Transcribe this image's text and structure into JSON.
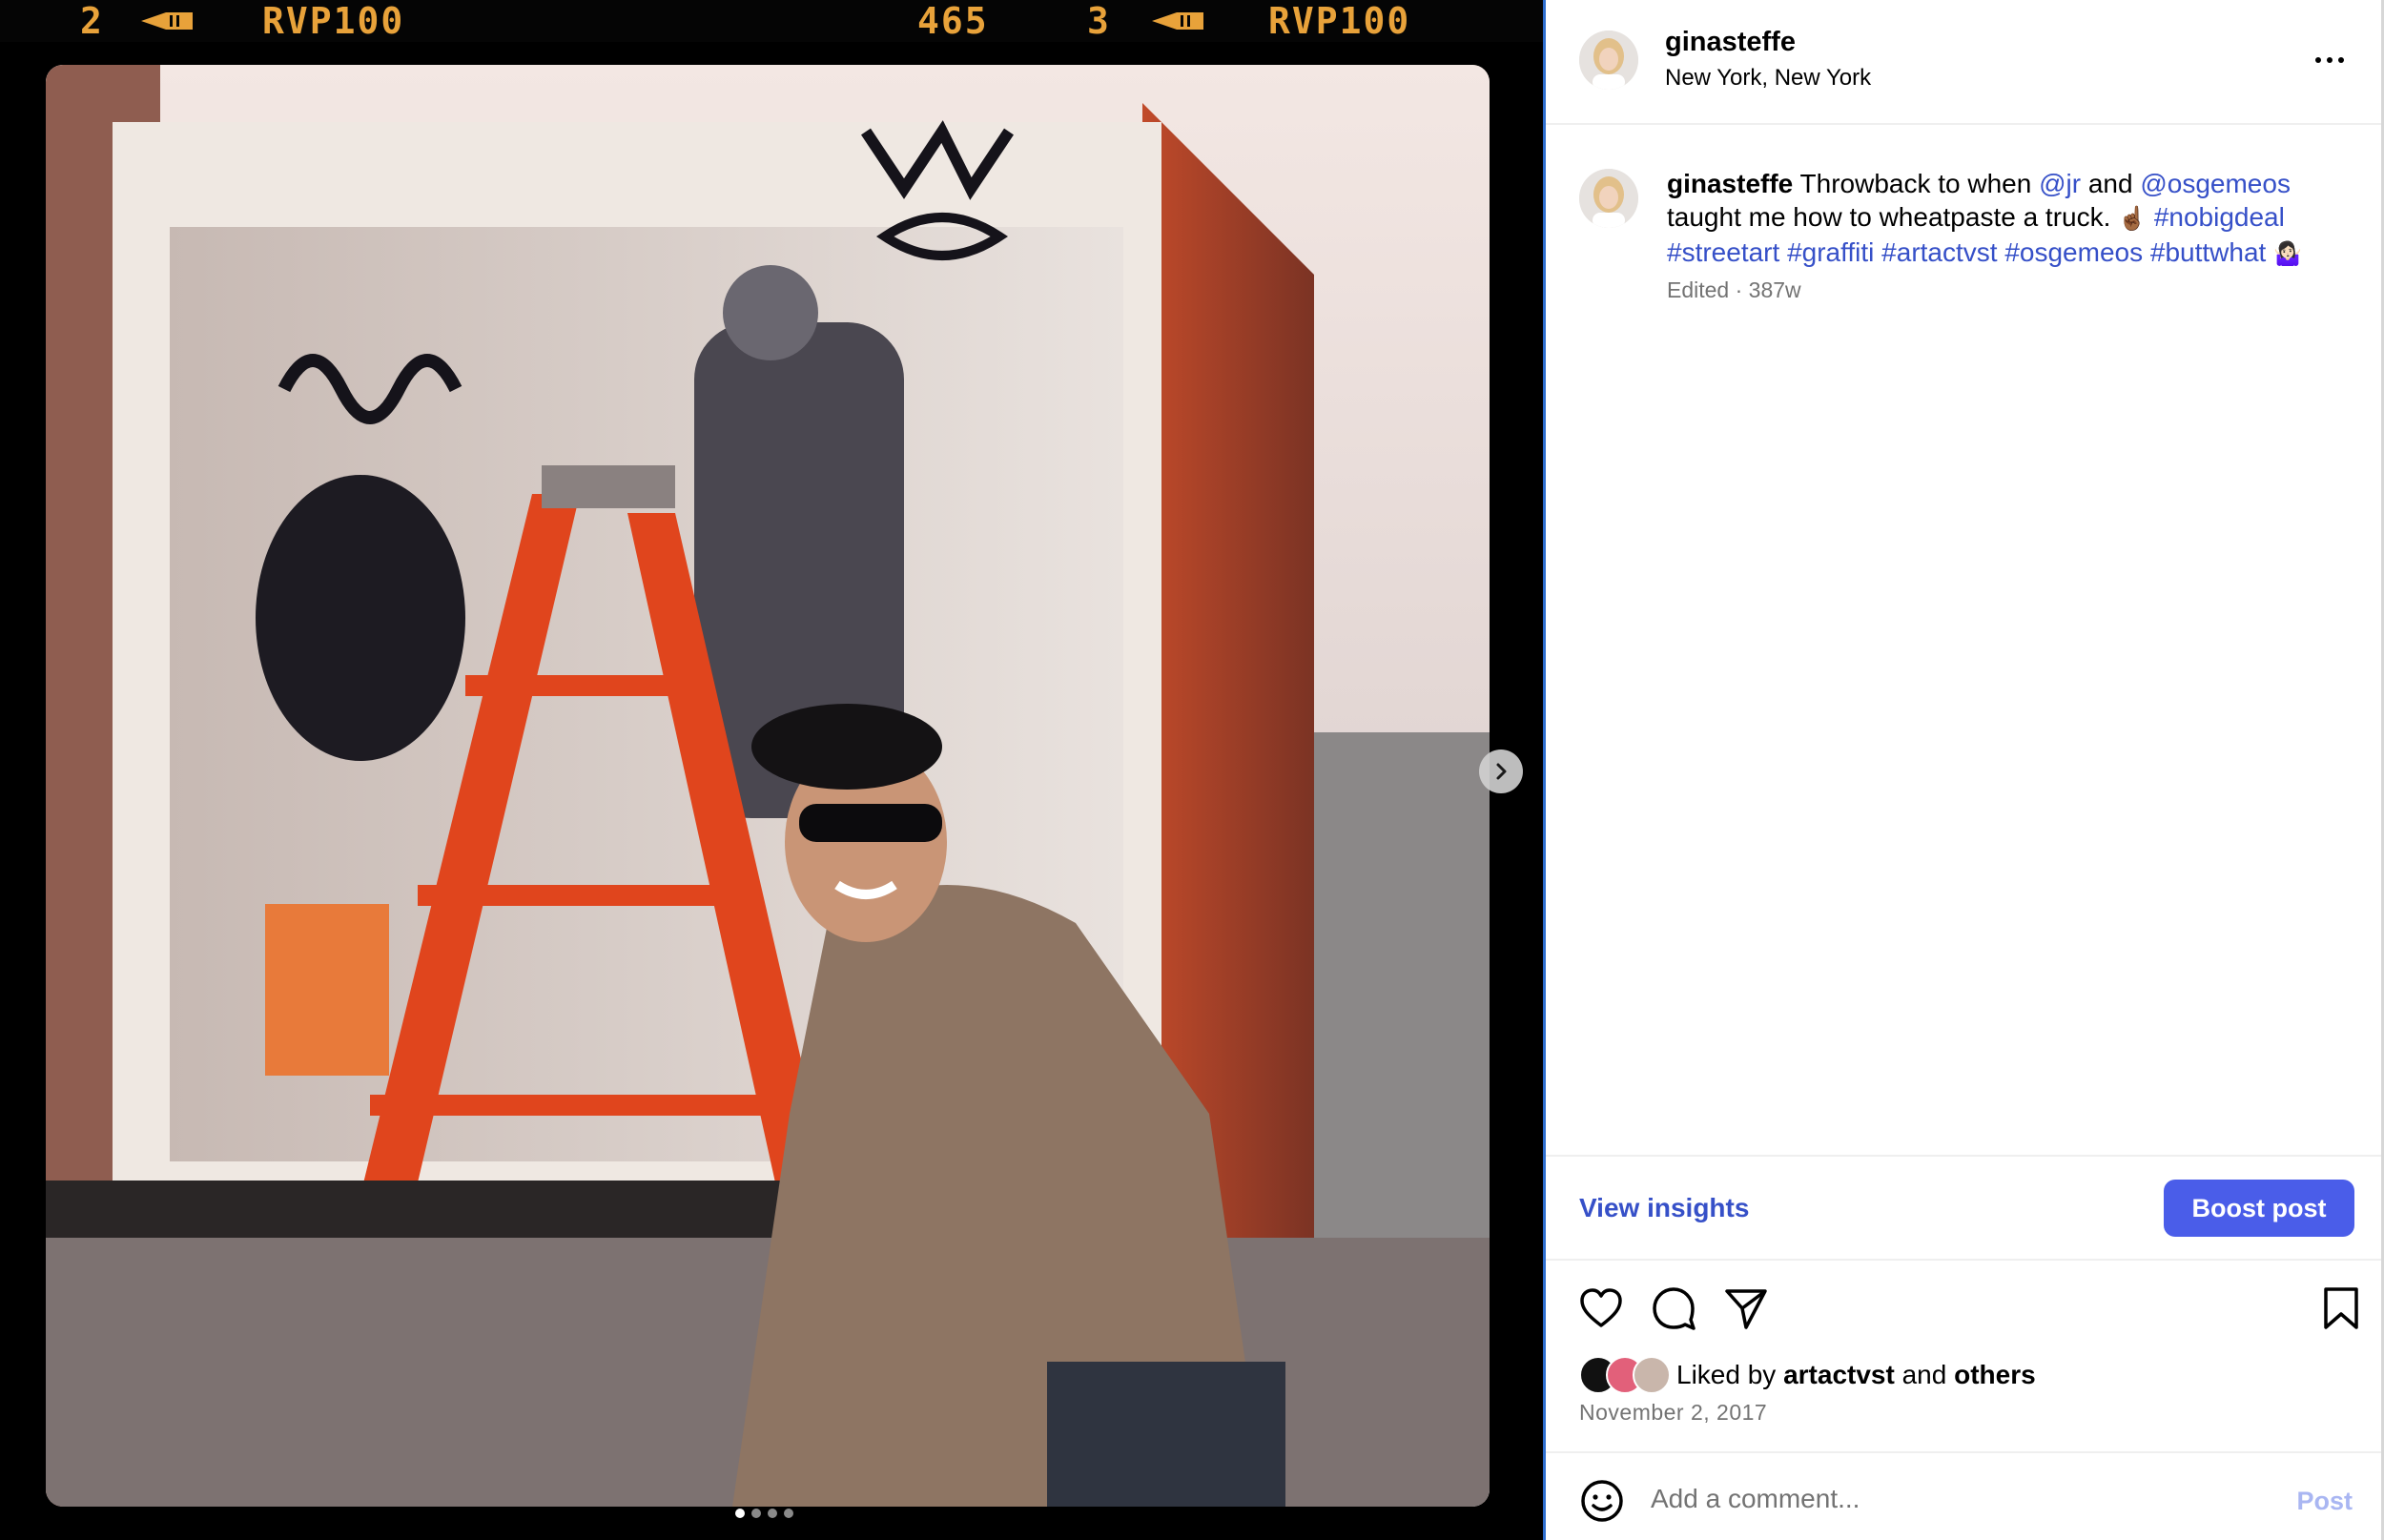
{
  "media": {
    "film_strip": {
      "frame_left": "2",
      "code_left": "RVP100",
      "number_center": "465",
      "frame_right": "3",
      "code_right": "RVP100"
    },
    "image_description_icon": "photo",
    "next_icon": "chevron-right-icon",
    "carousel": {
      "total": 4,
      "active_index": 0
    }
  },
  "post": {
    "username": "ginasteffe",
    "location": "New York, New York",
    "more_icon": "more-horizontal-icon",
    "caption": {
      "username": "ginasteffe",
      "text_1": " Throwback to when ",
      "mention_1": "@jr",
      "text_2": " and ",
      "mention_2": "@osgemeos",
      "text_3": " taught me how to wheatpaste a truck. ",
      "emoji_1": "☝🏾",
      "hashtags": [
        "#nobigdeal",
        "#streetart",
        "#graffiti",
        "#artactvst",
        "#osgemeos",
        "#buttwhat"
      ],
      "emoji_2": "🤷🏻‍♀️"
    },
    "meta": "Edited · 387w",
    "insights_label": "View insights",
    "boost_label": "Boost post",
    "liked_prefix": "Liked by ",
    "liked_user": "artactvst",
    "liked_middle": " and ",
    "liked_others": "others",
    "date": "November 2, 2017",
    "comment_placeholder": "Add a comment...",
    "post_label": "Post"
  },
  "colors": {
    "link": "#3650c8",
    "boost_bg": "#4a5de9",
    "post_disabled": "#a9b6f2",
    "film_text": "#e8a23a"
  }
}
